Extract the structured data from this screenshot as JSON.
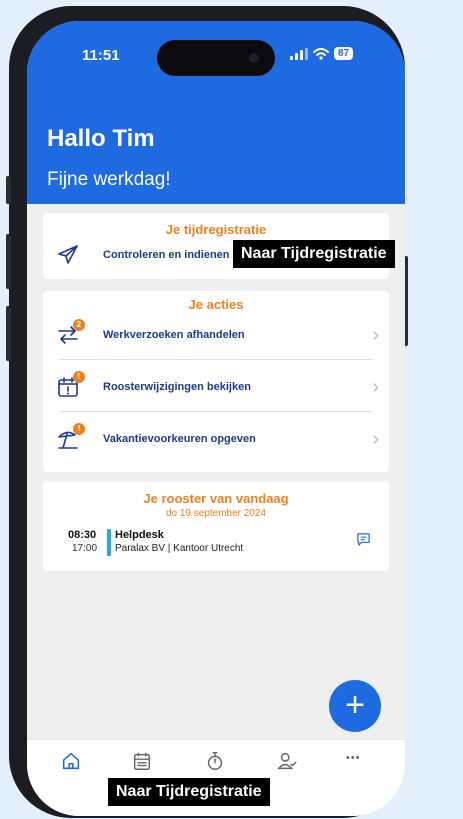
{
  "status": {
    "time": "11:51",
    "battery": "87"
  },
  "header": {
    "greeting": "Hallo Tim",
    "subtitle": "Fijne werkdag!"
  },
  "tijdregistratie": {
    "title": "Je tijdregistratie",
    "action_label": "Controleren en indienen"
  },
  "acties": {
    "title": "Je acties",
    "items": [
      {
        "label": "Werkverzoeken afhandelen",
        "badge": "2",
        "icon": "swap-arrows-icon"
      },
      {
        "label": "Roosterwijzigingen bekijken",
        "badge": "!",
        "icon": "calendar-alert-icon"
      },
      {
        "label": "Vakantievoorkeuren opgeven",
        "badge": "!",
        "icon": "beach-umbrella-icon"
      }
    ]
  },
  "rooster": {
    "title": "Je rooster van vandaag",
    "date": "do 19 september 2024",
    "shift": {
      "start": "08:30",
      "end": "17:00",
      "name": "Helpdesk",
      "location": "Paralax BV | Kantoor Utrecht"
    }
  },
  "tooltip_top": "Naar Tijdregistratie",
  "tooltip_bottom": "Naar Tijdregistratie",
  "fab_label": "+",
  "more_label": "•••",
  "colors": {
    "brand": "#1e6ae0",
    "accent": "#f0801e",
    "navy": "#1d3a8a"
  }
}
